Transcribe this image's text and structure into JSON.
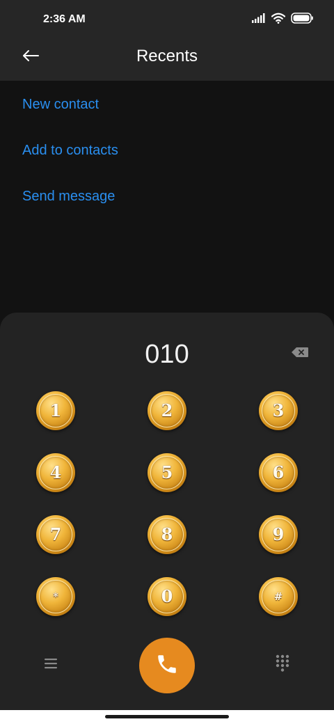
{
  "status_bar": {
    "time": "2:36 AM",
    "icons": [
      "signal-icon",
      "wifi-icon",
      "battery-icon"
    ]
  },
  "header": {
    "title": "Recents",
    "back_icon": "arrow-left-icon"
  },
  "actions": [
    {
      "label": "New contact"
    },
    {
      "label": "Add to contacts"
    },
    {
      "label": "Send message"
    }
  ],
  "dialer": {
    "number": "010",
    "backspace_icon": "backspace-icon",
    "keys": [
      {
        "digit": "1"
      },
      {
        "digit": "2"
      },
      {
        "digit": "3"
      },
      {
        "digit": "4"
      },
      {
        "digit": "5"
      },
      {
        "digit": "6"
      },
      {
        "digit": "7"
      },
      {
        "digit": "8"
      },
      {
        "digit": "9"
      },
      {
        "digit": "*"
      },
      {
        "digit": "0"
      },
      {
        "digit": "#"
      }
    ]
  },
  "bottom_bar": {
    "menu_icon": "menu-icon",
    "call_icon": "phone-icon",
    "dialpad_icon": "dialpad-icon"
  },
  "colors": {
    "background": "#121212",
    "header": "#262626",
    "dialer_sheet": "#232323",
    "link": "#2a8ff0",
    "call_button": "#e68a1f",
    "key_gold": "#e0a030"
  }
}
